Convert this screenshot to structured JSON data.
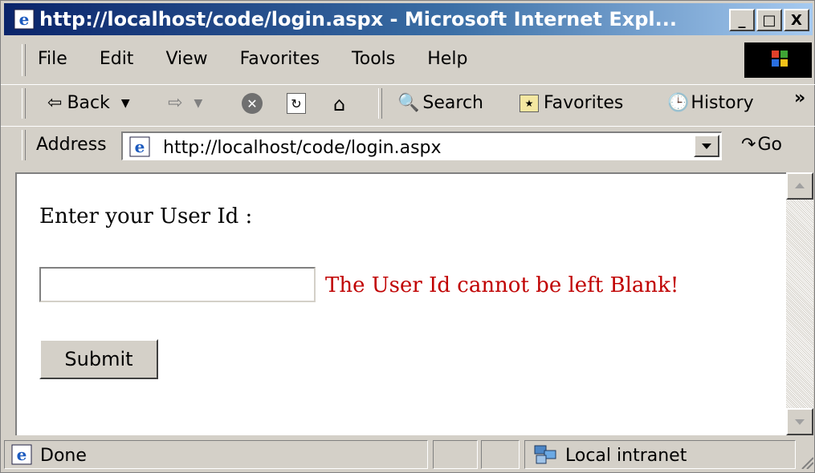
{
  "window": {
    "title": "http://localhost/code/login.aspx - Microsoft Internet Expl...",
    "minimize": "_",
    "maximize": "□",
    "close": "X"
  },
  "menu": {
    "items": [
      "File",
      "Edit",
      "View",
      "Favorites",
      "Tools",
      "Help"
    ]
  },
  "toolbar": {
    "back": "Back",
    "search": "Search",
    "favorites": "Favorites",
    "history": "History",
    "more": "»"
  },
  "address": {
    "label": "Address",
    "url": "http://localhost/code/login.aspx",
    "go": "Go"
  },
  "page": {
    "prompt": "Enter your User Id :",
    "userid_value": "",
    "error": "The User Id cannot be left Blank!",
    "submit": "Submit"
  },
  "status": {
    "text": "Done",
    "zone": "Local intranet"
  },
  "colors": {
    "error": "#c00000",
    "titlebar_start": "#0a246a",
    "titlebar_end": "#a6caf0",
    "chrome": "#d4d0c8"
  }
}
